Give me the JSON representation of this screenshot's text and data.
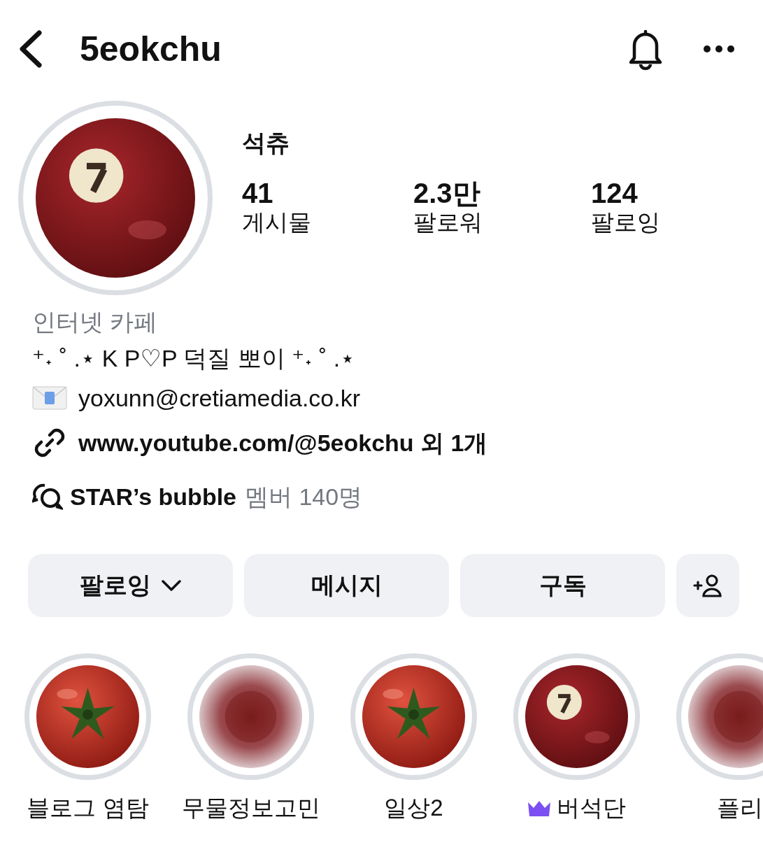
{
  "header": {
    "title": "5eokchu"
  },
  "profile": {
    "name": "석츄",
    "stats": [
      {
        "value": "41",
        "label": "게시물"
      },
      {
        "value": "2.3만",
        "label": "팔로워"
      },
      {
        "value": "124",
        "label": "팔로잉"
      }
    ]
  },
  "bio": {
    "category": "인터넷 카페",
    "text": "⁺˖ ˚ .⋆ K P♡P 덕질 뽀이 ⁺˖ ˚ .⋆",
    "email": "yoxunn@cretiamedia.co.kr",
    "link": "www.youtube.com/@5eokchu 외 1개",
    "channel": "STAR’s bubble",
    "channel_members": "멤버 140명"
  },
  "buttons": [
    {
      "label": "팔로잉",
      "dropdown": true
    },
    {
      "label": "메시지",
      "dropdown": false
    },
    {
      "label": "구독",
      "dropdown": false
    }
  ],
  "highlights": [
    {
      "label": "블로그 염탐",
      "crown": false,
      "kind": "picture"
    },
    {
      "label": "무물정보고민",
      "crown": false,
      "kind": "picture"
    },
    {
      "label": "일상2",
      "crown": false,
      "kind": "picture"
    },
    {
      "label": "버석단",
      "crown": true,
      "kind": "picture"
    },
    {
      "label": "플리",
      "crown": false,
      "kind": "picture"
    }
  ]
}
